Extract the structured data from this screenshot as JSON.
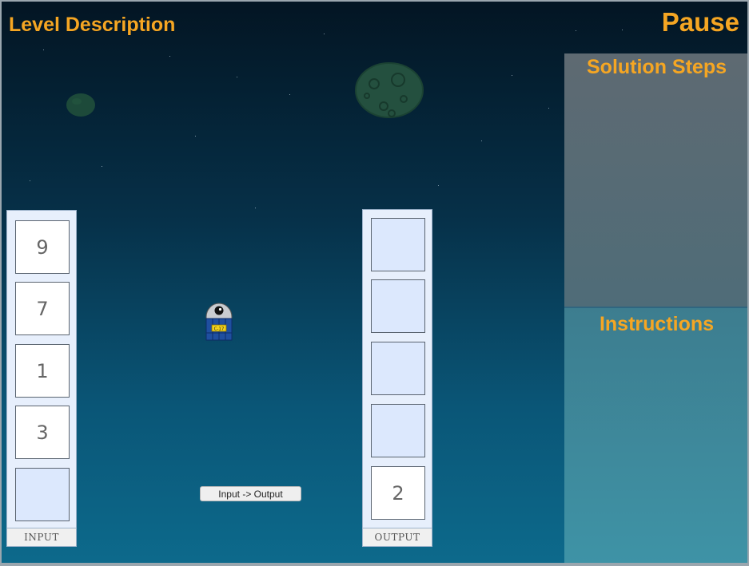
{
  "header": {
    "level_description": "Level Description",
    "pause": "Pause"
  },
  "panels": {
    "solution_steps": "Solution Steps",
    "instructions": "Instructions"
  },
  "input": {
    "label": "INPUT",
    "slots": [
      "9",
      "7",
      "1",
      "3",
      ""
    ]
  },
  "output": {
    "label": "OUTPUT",
    "slots": [
      "",
      "",
      "",
      "",
      "2"
    ]
  },
  "controls": {
    "run_button": "Input -> Output"
  },
  "robot": {
    "badge": "C-17"
  },
  "colors": {
    "accent": "#f5a623",
    "slot_empty": "#dce8fd",
    "slot_filled": "#ffffff"
  },
  "icons": {
    "robot": "robot-sprite-icon",
    "planet": "cratered-planet-icon"
  }
}
